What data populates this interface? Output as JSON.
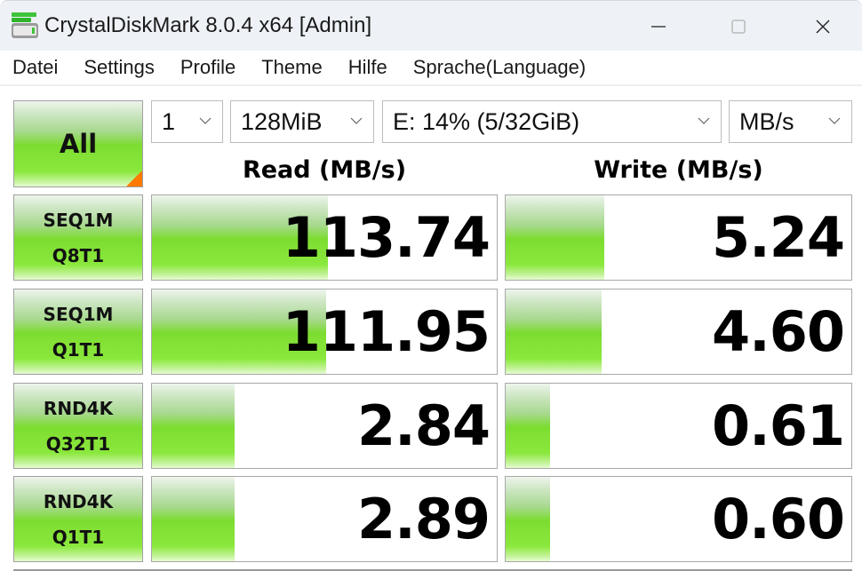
{
  "window": {
    "title": "CrystalDiskMark 8.0.4 x64 [Admin]",
    "app_icon": "crystaldiskmark-drive-icon",
    "controls": {
      "minimize": "minimize-icon",
      "maximize": "maximize-icon",
      "close": "close-icon"
    }
  },
  "menu": {
    "items": [
      "Datei",
      "Settings",
      "Profile",
      "Theme",
      "Hilfe",
      "Sprache(Language)"
    ]
  },
  "toolbar": {
    "all_button": "All",
    "queues": {
      "value": "1"
    },
    "size": {
      "value": "128MiB"
    },
    "drive": {
      "value": "E: 14% (5/32GiB)"
    },
    "unit": {
      "value": "MB/s"
    }
  },
  "headers": {
    "read": "Read (MB/s)",
    "write": "Write (MB/s)"
  },
  "colors": {
    "bar_green": "#7bdc2f",
    "all_corner_accent": "#ff7a00"
  },
  "tests": [
    {
      "line1": "SEQ1M",
      "line2": "Q8T1",
      "read": "113.74",
      "write": "5.24",
      "read_bar_fraction": 0.51,
      "write_bar_fraction": 0.285
    },
    {
      "line1": "SEQ1M",
      "line2": "Q1T1",
      "read": "111.95",
      "write": "4.60",
      "read_bar_fraction": 0.505,
      "write_bar_fraction": 0.278
    },
    {
      "line1": "RND4K",
      "line2": "Q32T1",
      "read": "2.84",
      "write": "0.61",
      "read_bar_fraction": 0.24,
      "write_bar_fraction": 0.128
    },
    {
      "line1": "RND4K",
      "line2": "Q1T1",
      "read": "2.89",
      "write": "0.60",
      "read_bar_fraction": 0.24,
      "write_bar_fraction": 0.128
    }
  ]
}
